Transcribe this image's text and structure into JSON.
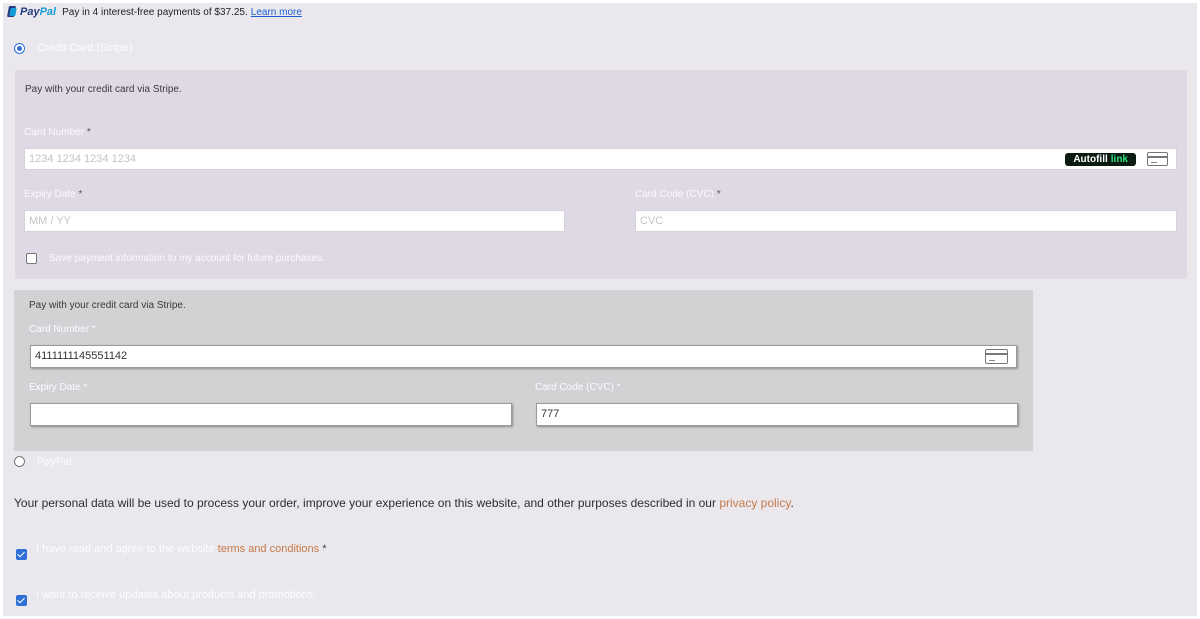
{
  "paypal_banner": {
    "logo_text_1": "Pay",
    "logo_text_2": "Pal",
    "message": "Pay in 4 interest-free payments of $37.25.",
    "link": "Learn more"
  },
  "payment_methods": {
    "credit_card_label": "Credit Card (Stripe)",
    "paypal_label": "PayPal"
  },
  "stripe_form": {
    "description": "Pay with your credit card via Stripe.",
    "card_number_label": "Card Number",
    "card_number_placeholder": "1234 1234 1234 1234",
    "autofill_text": "Autofill",
    "autofill_link": "link",
    "expiry_label": "Expiry Date",
    "expiry_placeholder": "MM / YY",
    "cvc_label": "Card Code (CVC)",
    "cvc_placeholder": "CVC",
    "required_mark": "*",
    "save_info_label": "Save payment information to my account for future purchases."
  },
  "legacy_form": {
    "description": "Pay with your credit card via Stripe.",
    "card_number_label": "Card Number *",
    "card_number_value": "4111111145551142",
    "expiry_label": "Expiry Date *",
    "expiry_value": "",
    "cvc_label": "Card Code (CVC) *",
    "cvc_value": "777"
  },
  "privacy": {
    "text": "Your personal data will be used to process your order, improve your experience on this website, and other purposes described in our",
    "link": "privacy policy",
    "end": "."
  },
  "terms": {
    "text": "I have read and agree to the website",
    "link": "terms and conditions",
    "required_mark": "*"
  },
  "newsletter": {
    "text": "I want to receive updates about products and promotions."
  }
}
